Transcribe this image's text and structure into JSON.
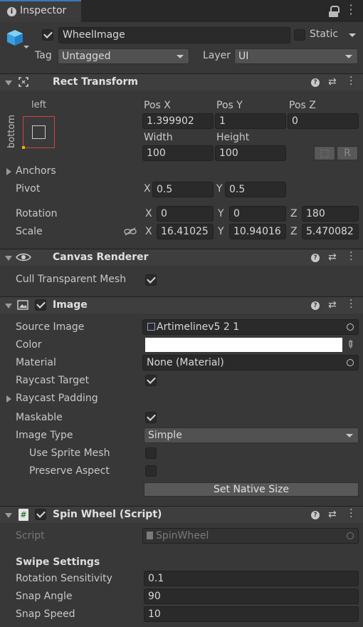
{
  "tab": {
    "title": "Inspector"
  },
  "gameobject": {
    "name": "WheelImage",
    "static_label": "Static",
    "tag_label": "Tag",
    "tag_value": "Untagged",
    "layer_label": "Layer",
    "layer_value": "UI"
  },
  "rect_transform": {
    "title": "Rect Transform",
    "anchor_preset": {
      "horizontal": "left",
      "vertical": "bottom"
    },
    "pos_x_label": "Pos X",
    "pos_y_label": "Pos Y",
    "pos_z_label": "Pos Z",
    "pos_x": "1.399902",
    "pos_y": "1",
    "pos_z": "0",
    "width_label": "Width",
    "height_label": "Height",
    "width": "100",
    "height": "100",
    "raw_button": "R",
    "anchors_label": "Anchors",
    "pivot_label": "Pivot",
    "pivot_x": "0.5",
    "pivot_y": "0.5",
    "rotation_label": "Rotation",
    "rot_x": "0",
    "rot_y": "0",
    "rot_z": "180",
    "scale_label": "Scale",
    "scale_x": "16.41025",
    "scale_y": "10.94016",
    "scale_z": "5.470082",
    "x": "X",
    "y": "Y",
    "z": "Z"
  },
  "canvas_renderer": {
    "title": "Canvas Renderer",
    "cull_label": "Cull Transparent Mesh",
    "cull_checked": true
  },
  "image": {
    "title": "Image",
    "source_label": "Source Image",
    "source_value": "Artimelinev5 2 1",
    "color_label": "Color",
    "color_value": "#ffffff",
    "material_label": "Material",
    "material_value": "None (Material)",
    "raycast_target_label": "Raycast Target",
    "raycast_padding_label": "Raycast Padding",
    "maskable_label": "Maskable",
    "image_type_label": "Image Type",
    "image_type_value": "Simple",
    "use_sprite_mesh_label": "Use Sprite Mesh",
    "preserve_aspect_label": "Preserve Aspect",
    "set_native_size": "Set Native Size"
  },
  "spin_wheel": {
    "title": "Spin Wheel (Script)",
    "script_label": "Script",
    "script_value": "SpinWheel",
    "swipe_settings": "Swipe Settings",
    "rotation_sensitivity_label": "Rotation Sensitivity",
    "rotation_sensitivity": "0.1",
    "snap_angle_label": "Snap Angle",
    "snap_angle": "90",
    "snap_speed_label": "Snap Speed",
    "snap_speed": "10"
  }
}
